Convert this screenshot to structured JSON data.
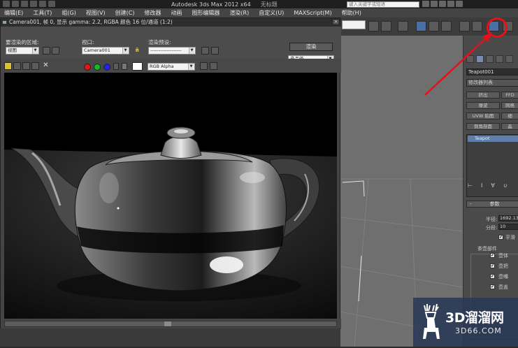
{
  "titlebar": {
    "app_title": "Autodesk 3ds Max  2012 x64",
    "doc_title": "无标题",
    "search_placeholder": "键入关键字或短语"
  },
  "menubar": {
    "items": [
      "编辑(E)",
      "工具(T)",
      "组(G)",
      "视图(V)",
      "创建(C)",
      "修改器",
      "动画",
      "图形编辑器",
      "渲染(R)",
      "自定义(U)",
      "MAXScript(M)",
      "帮助(H)"
    ]
  },
  "render_window": {
    "title": "Camera001, 帧 0, 显示 gamma: 2.2, RGBA 颜色 16 位/通道 (1:2)",
    "area_label": "要渲染的区域:",
    "area_value": "视图",
    "viewport_label": "视口:",
    "viewport_value": "Camera001",
    "preset_label": "渲染预设:",
    "preset_value": "-------------------",
    "render_button": "渲染",
    "output_value": "产品级",
    "channel_value": "RGB Alpha",
    "close_glyph": "×"
  },
  "command_panel": {
    "object_name": "Teapot001",
    "modifier_list": "修改器列表",
    "buttons": [
      "挤出",
      "FFD",
      "噪波",
      "网格",
      "UVW 贴图",
      "细",
      "倒角剖面",
      "晶"
    ],
    "stack_item": "Teapot",
    "rollout_title": "参数",
    "radius_label": "半径:",
    "radius_value": "1692.137",
    "segments_label": "分段:",
    "segments_value": "10",
    "smooth_label": "平滑",
    "parts_label": "茶壶部件",
    "parts": [
      "壶体",
      "壶把",
      "壶嘴",
      "壶盖"
    ],
    "check_glyph": "✔"
  },
  "watermark": {
    "title": "3D溜溜网",
    "subtitle": "3D66.COM"
  },
  "colors": {
    "highlight": "#e8101b",
    "stack_selected": "#5f7ea8"
  }
}
